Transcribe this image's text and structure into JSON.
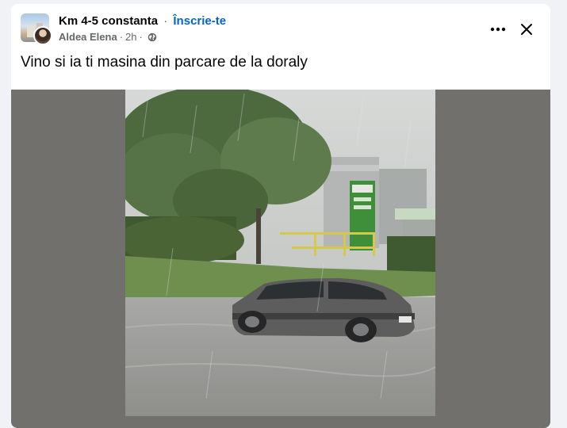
{
  "post": {
    "group_name": "Km 4-5 constanta",
    "separator": "·",
    "join_label": "Înscrie-te",
    "author": "Aldea Elena",
    "time_separator": "·",
    "time": "2h",
    "privacy_icon": "globe-icon",
    "text": "Vino si ia ti masina din parcare de la doraly"
  },
  "icons": {
    "more": "more-options-icon",
    "close": "close-icon"
  },
  "colors": {
    "link": "#0064d1",
    "secondary_text": "#65676b",
    "media_background": "#72706c"
  }
}
